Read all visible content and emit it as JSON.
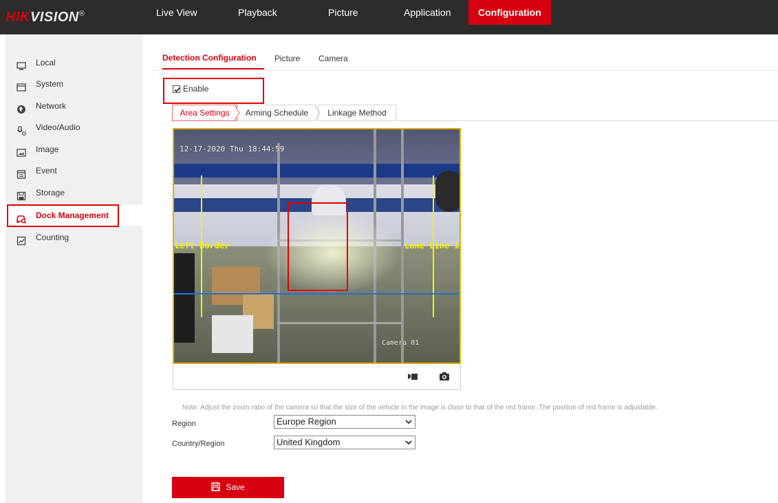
{
  "brand": {
    "hik": "HIK",
    "vision": "VISION",
    "reg": "®"
  },
  "topnav": {
    "items": [
      {
        "label": "Live View"
      },
      {
        "label": "Playback"
      },
      {
        "label": "Picture"
      },
      {
        "label": "Application"
      },
      {
        "label": "Configuration",
        "active": true
      }
    ]
  },
  "sidebar": {
    "items": [
      {
        "label": "Local",
        "icon": "monitor-icon"
      },
      {
        "label": "System",
        "icon": "window-icon"
      },
      {
        "label": "Network",
        "icon": "globe-icon"
      },
      {
        "label": "Video/Audio",
        "icon": "microphone-icon"
      },
      {
        "label": "Image",
        "icon": "image-icon"
      },
      {
        "label": "Event",
        "icon": "calendar-icon"
      },
      {
        "label": "Storage",
        "icon": "save-icon"
      },
      {
        "label": "Dock Management",
        "icon": "car-search-icon",
        "active": true
      },
      {
        "label": "Counting",
        "icon": "chart-icon"
      }
    ]
  },
  "tabs": {
    "detection": "Detection Configuration",
    "picture": "Picture",
    "camera": "Camera"
  },
  "enable": {
    "label": "Enable",
    "checked": true
  },
  "subtabs": {
    "area": "Area Settings",
    "arming": "Arming Schedule",
    "linkage": "Linkage Method"
  },
  "video": {
    "timestamp": "12-17-2020 Thu 18:44:59",
    "camera_name": "Camera 01",
    "left_border_label": "Left Border",
    "lane_line_label": "Lane Line 1",
    "line_color": "#f2f200",
    "frame_color": "#e00000"
  },
  "video_toolbar": {
    "record_icon": "record-icon",
    "snapshot_icon": "camera-icon"
  },
  "note": "Note: Adjust the zoom ratio of the camera so that the size of the vehicle in the image is close to that of the red frame. The position of red frame is adjustable.",
  "form": {
    "region_label": "Region",
    "region_value": "Europe Region",
    "country_label": "Country/Region",
    "country_value": "United Kingdom"
  },
  "save": {
    "label": "Save"
  },
  "colors": {
    "accent": "#d7000f",
    "topbar": "#2c2c2c",
    "sidebar": "#f0f0f0"
  }
}
